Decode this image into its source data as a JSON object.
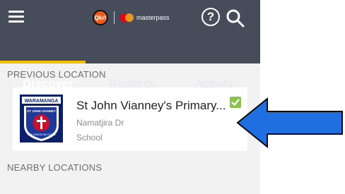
{
  "header": {
    "menu_icon": "hamburger-menu-icon",
    "qkr_logo_text": "Qkr!",
    "masterpass_text": "masterpass",
    "help_icon": "question-circle-icon",
    "search_icon": "search-icon"
  },
  "tabs": [
    {
      "label": "Discover",
      "active": true
    },
    {
      "label": "Rewards",
      "active": false
    },
    {
      "label": "Activity",
      "active": false
    }
  ],
  "sections": {
    "previous": "PREVIOUS LOCATION",
    "nearby": "NEARBY LOCATIONS"
  },
  "location": {
    "name": "St John Vianney's Primary...",
    "address": "Namatjira Dr",
    "type": "School",
    "badge_text": "WARAMANGA",
    "badge_arc": "ST JOHN VIANNEY",
    "badge_motto": "THY KINGDOM COME",
    "verified": true
  },
  "colors": {
    "header_bg": "#464c5a",
    "tab_indicator": "#f5c000",
    "check": "#8bc34a",
    "arrow": "#1f6fe0"
  },
  "annotation": {
    "arrow_icon": "left-arrow-icon"
  }
}
